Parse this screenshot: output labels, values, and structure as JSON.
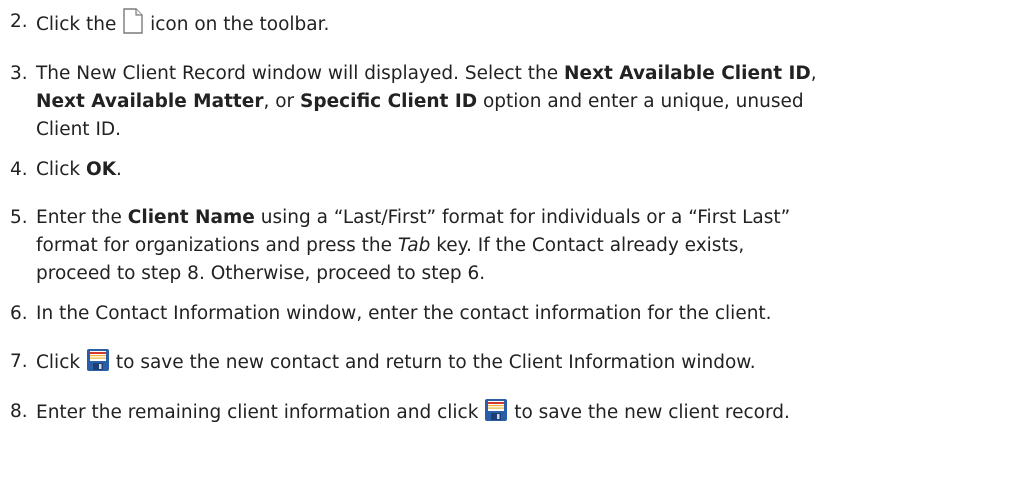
{
  "steps": [
    {
      "number": "2.",
      "parts": {
        "a": "Click the",
        "b": "icon on the toolbar."
      },
      "icon": "new-document-icon"
    },
    {
      "number": "3.",
      "parts": {
        "a": "The New Client Record window will displayed. Select the",
        "b": "Next Available Client ID",
        "c": ",",
        "d": "Next Available Matter",
        "e": ", or",
        "f": "Specific Client ID",
        "g": "option and enter a unique, unused",
        "h": "Client ID."
      }
    },
    {
      "number": "4.",
      "parts": {
        "a": "Click",
        "b": "OK",
        "c": "."
      }
    },
    {
      "number": "5.",
      "parts": {
        "a": "Enter the",
        "b": "Client Name",
        "c": "using a “Last/First” format for individuals or a “First Last”",
        "d": "format for organizations and press the",
        "e": "Tab",
        "f": "key. If the Contact already exists,",
        "g": "proceed to step 8. Otherwise, proceed to step 6."
      }
    },
    {
      "number": "6.",
      "parts": {
        "a": "In the Contact Information window, enter the contact information for the client."
      }
    },
    {
      "number": "7.",
      "parts": {
        "a": "Click",
        "b": "to save the new contact and return to the Client Information window."
      },
      "icon": "save-icon"
    },
    {
      "number": "8.",
      "parts": {
        "a": "Enter the remaining client information and click",
        "b": "to save the new client record."
      },
      "icon": "save-icon"
    }
  ],
  "colors": {
    "text": "#222222",
    "save_icon_blue": "#2a5fa8",
    "save_icon_red": "#d23a2e"
  }
}
